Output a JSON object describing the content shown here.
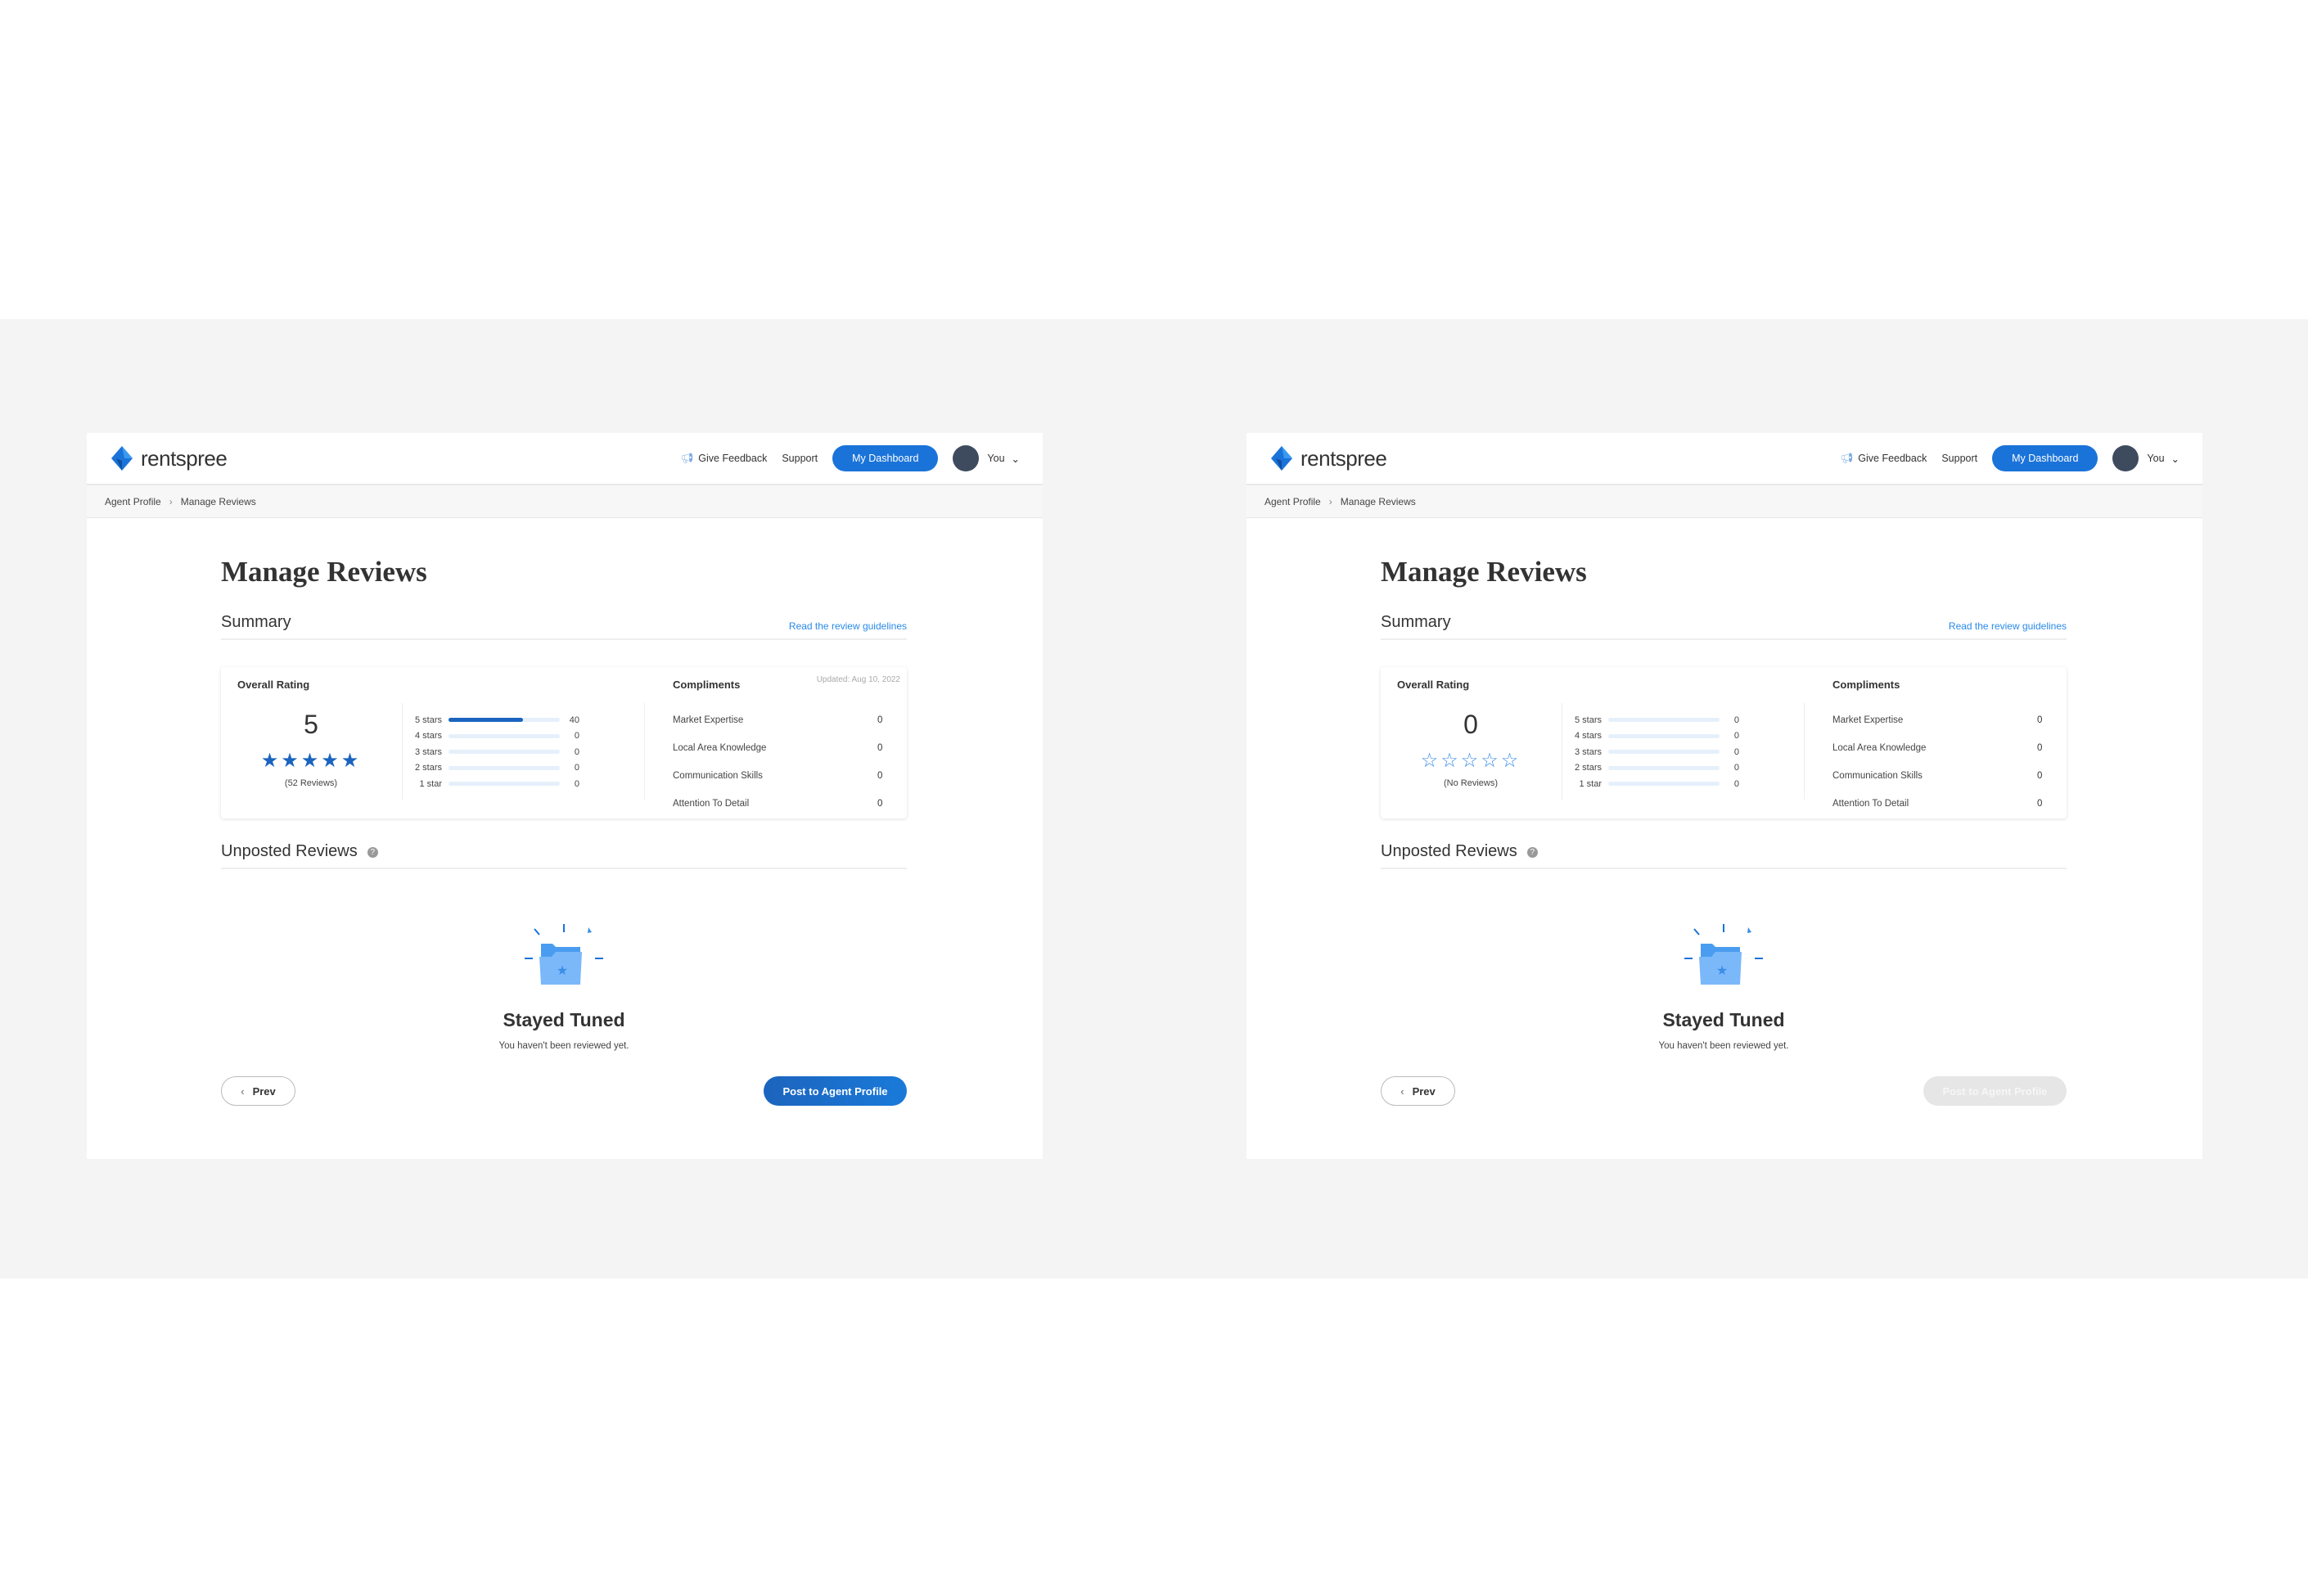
{
  "colors": {
    "brand": "#1a73d9",
    "star_fill": "#1a64c0",
    "star_outline": "#3a8ee6",
    "bar_track": "#e6f0fb",
    "background": "#f4f4f4"
  },
  "panels": [
    {
      "header": {
        "logo_text": "rentspree",
        "feedback": "Give Feedback",
        "support": "Support",
        "dashboard": "My Dashboard",
        "user": "You"
      },
      "breadcrumb": [
        "Agent Profile",
        "Manage Reviews"
      ],
      "title": "Manage Reviews",
      "summary": {
        "heading": "Summary",
        "guidelines_link": "Read the review guidelines"
      },
      "card": {
        "overall_label": "Overall Rating",
        "rating": "5",
        "stars_filled": 5,
        "review_count": "(52 Reviews)",
        "updated": "Updated: Aug 10, 2022",
        "distribution": [
          {
            "label": "5 stars",
            "value": "40",
            "fraction": 0.67
          },
          {
            "label": "4 stars",
            "value": "0",
            "fraction": 0
          },
          {
            "label": "3 stars",
            "value": "0",
            "fraction": 0
          },
          {
            "label": "2 stars",
            "value": "0",
            "fraction": 0
          },
          {
            "label": "1 star",
            "value": "0",
            "fraction": 0
          }
        ],
        "compliments_label": "Compliments",
        "compliments": [
          {
            "label": "Market Expertise",
            "value": "0"
          },
          {
            "label": "Local Area Knowledge",
            "value": "0"
          },
          {
            "label": "Communication Skills",
            "value": "0"
          },
          {
            "label": "Attention To Detail",
            "value": "0"
          }
        ]
      },
      "unposted": {
        "heading": "Unposted Reviews",
        "empty_title": "Stayed Tuned",
        "empty_text": "You haven't been reviewed yet."
      },
      "buttons": {
        "prev": "Prev",
        "post": "Post to Agent Profile",
        "post_disabled": false
      }
    },
    {
      "header": {
        "logo_text": "rentspree",
        "feedback": "Give Feedback",
        "support": "Support",
        "dashboard": "My Dashboard",
        "user": "You"
      },
      "breadcrumb": [
        "Agent Profile",
        "Manage Reviews"
      ],
      "title": "Manage Reviews",
      "summary": {
        "heading": "Summary",
        "guidelines_link": "Read the review guidelines"
      },
      "card": {
        "overall_label": "Overall Rating",
        "rating": "0",
        "stars_filled": 0,
        "review_count": "(No Reviews)",
        "distribution": [
          {
            "label": "5 stars",
            "value": "0",
            "fraction": 0
          },
          {
            "label": "4 stars",
            "value": "0",
            "fraction": 0
          },
          {
            "label": "3 stars",
            "value": "0",
            "fraction": 0
          },
          {
            "label": "2 stars",
            "value": "0",
            "fraction": 0
          },
          {
            "label": "1 star",
            "value": "0",
            "fraction": 0
          }
        ],
        "compliments_label": "Compliments",
        "compliments": [
          {
            "label": "Market Expertise",
            "value": "0"
          },
          {
            "label": "Local Area Knowledge",
            "value": "0"
          },
          {
            "label": "Communication Skills",
            "value": "0"
          },
          {
            "label": "Attention To Detail",
            "value": "0"
          }
        ]
      },
      "unposted": {
        "heading": "Unposted Reviews",
        "empty_title": "Stayed Tuned",
        "empty_text": "You haven't been reviewed yet."
      },
      "buttons": {
        "prev": "Prev",
        "post": "Post to Agent Profile",
        "post_disabled": true
      }
    }
  ]
}
